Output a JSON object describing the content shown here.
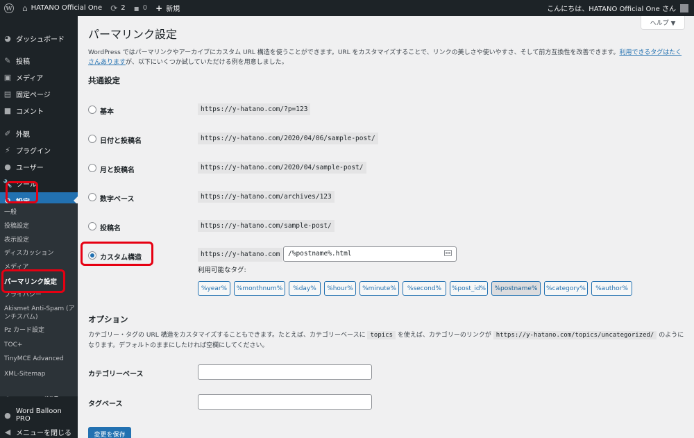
{
  "adminbar": {
    "site_name": "HATANO Official One",
    "updates_count": "2",
    "comments_count": "0",
    "new_label": "新規",
    "greeting": "こんにちは、HATANO Official One さん"
  },
  "sidebar": {
    "items": [
      {
        "label": "ダッシュボード",
        "icon": "dashboard-icon",
        "glyph": "◕"
      },
      {
        "label": "投稿",
        "icon": "pin-icon",
        "glyph": "✎"
      },
      {
        "label": "メディア",
        "icon": "media-icon",
        "glyph": "▣"
      },
      {
        "label": "固定ページ",
        "icon": "page-icon",
        "glyph": "▤"
      },
      {
        "label": "コメント",
        "icon": "comment-icon",
        "glyph": "■"
      },
      {
        "label": "外観",
        "icon": "brush-icon",
        "glyph": "✐"
      },
      {
        "label": "プラグイン",
        "icon": "plugin-icon",
        "glyph": "⚡"
      },
      {
        "label": "ユーザー",
        "icon": "user-icon",
        "glyph": "●"
      },
      {
        "label": "ツール",
        "icon": "wrench-icon",
        "glyph": "🔧"
      },
      {
        "label": "設定",
        "icon": "settings-icon",
        "glyph": "⚙"
      }
    ],
    "submenu": [
      "一般",
      "投稿設定",
      "表示設定",
      "ディスカッション",
      "メディア",
      "パーマリンク設定",
      "プライバシー",
      "Akismet Anti-Spam (アンチスパム)",
      "Pz カード設定",
      "TOC+",
      "TinyMCE Advanced",
      "XML-Sitemap"
    ],
    "bottom_items": [
      {
        "label": "Emanon設定",
        "icon": "emanon-icon",
        "glyph": "●"
      },
      {
        "label": "Word Balloon PRO",
        "icon": "balloon-icon",
        "glyph": "●"
      },
      {
        "label": "メニューを閉じる",
        "icon": "collapse-icon",
        "glyph": "◀"
      }
    ]
  },
  "help_tab": "ヘルプ ▼",
  "page_title": "パーマリンク設定",
  "intro": {
    "text": "WordPress ではパーマリンクやアーカイブにカスタム URL 構造を使うことができます。URL をカスタマイズすることで、リンクの美しさや使いやすさ、そして前方互換性を改善できます。",
    "link": "利用できるタグはたくさんあります",
    "text_after": "が、以下にいくつか試していただける例を用意しました。"
  },
  "common_settings": {
    "title": "共通設定",
    "options": [
      {
        "label": "基本",
        "example": "https://y-hatano.com/?p=123",
        "checked": false
      },
      {
        "label": "日付と投稿名",
        "example": "https://y-hatano.com/2020/04/06/sample-post/",
        "checked": false
      },
      {
        "label": "月と投稿名",
        "example": "https://y-hatano.com/2020/04/sample-post/",
        "checked": false
      },
      {
        "label": "数字ベース",
        "example": "https://y-hatano.com/archives/123",
        "checked": false
      },
      {
        "label": "投稿名",
        "example": "https://y-hatano.com/sample-post/",
        "checked": false
      },
      {
        "label": "カスタム構造",
        "example": "https://y-hatano.com",
        "checked": true
      }
    ],
    "custom_structure_value": "/%postname%.html",
    "available_tags_label": "利用可能なタグ:",
    "tags": [
      "%year%",
      "%monthnum%",
      "%day%",
      "%hour%",
      "%minute%",
      "%second%",
      "%post_id%",
      "%postname%",
      "%category%",
      "%author%"
    ]
  },
  "options_section": {
    "title": "オプション",
    "desc_before": "カテゴリー・タグの URL 構造をカスタマイズすることもできます。たとえば、カテゴリーベースに",
    "desc_code1": "topics",
    "desc_middle": "を使えば、カテゴリーのリンクが",
    "desc_code2": "https://y-hatano.com/topics/uncategorized/",
    "desc_after": "のようになります。デフォルトのままにしたければ空欄にしてください。",
    "category_base_label": "カテゴリーベース",
    "tag_base_label": "タグベース",
    "category_base_value": "",
    "tag_base_value": ""
  },
  "save_button": "変更を保存"
}
